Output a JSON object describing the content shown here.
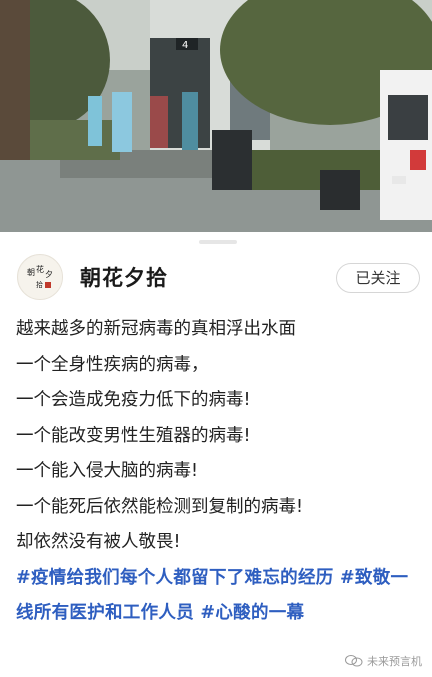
{
  "photo": {
    "building_number": "4"
  },
  "author": {
    "name": "朝花夕拾",
    "avatar_text": "朝花夕拾"
  },
  "follow_button": {
    "label": "已关注"
  },
  "post": {
    "lines": [
      "越来越多的新冠病毒的真相浮出水面",
      "一个全身性疾病的病毒，",
      "一个会造成免疫力低下的病毒!",
      "一个能改变男性生殖器的病毒!",
      "一个能入侵大脑的病毒!",
      "一个能死后依然能检测到复制的病毒!",
      "却依然没有被人敬畏!"
    ],
    "hashtags": "#疫情给我们每个人都留下了难忘的经历 #致敬一线所有医护和工作人员 #心酸的一幕"
  },
  "watermark": {
    "text": "未来预言机"
  },
  "colors": {
    "hashtag": "#2e5ec0",
    "text": "#222222"
  }
}
